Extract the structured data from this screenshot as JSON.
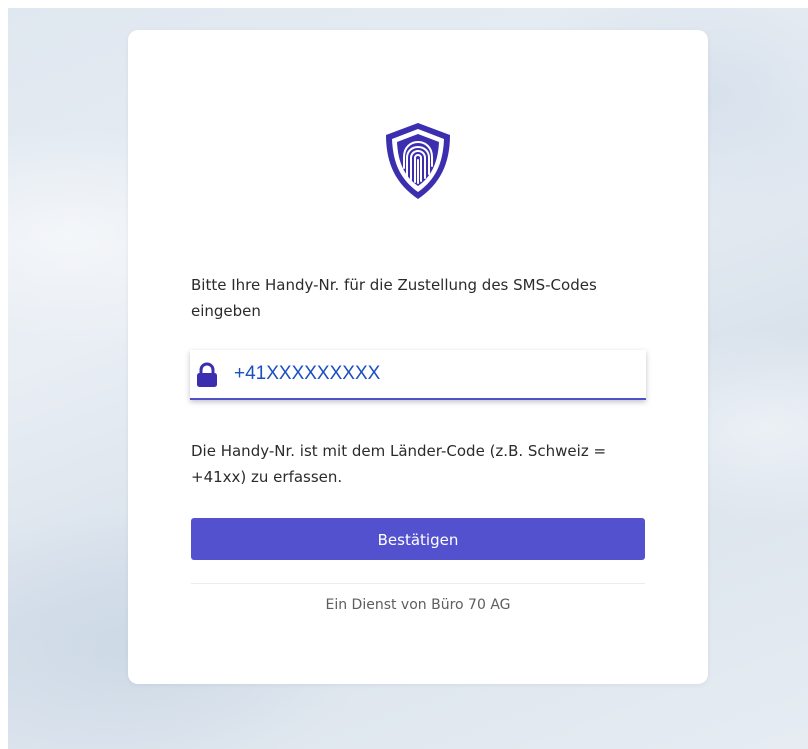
{
  "form": {
    "prompt": "Bitte Ihre Handy-Nr. für die Zustellung des SMS-Codes eingeben",
    "phone_value": "+41XXXXXXXXX",
    "hint": "Die Handy-Nr. ist mit dem Länder-Code (z.B. Schweiz = +41xx) zu erfassen.",
    "submit_label": "Bestätigen",
    "footer": "Ein Dienst von Büro 70 AG"
  },
  "icons": {
    "logo": "shield-fingerprint-icon",
    "field": "lock-icon"
  },
  "colors": {
    "accent": "#5451cf",
    "logo_primary": "#3b2fb0",
    "input_text": "#1a4fc4",
    "background": "#e3eaf2"
  }
}
